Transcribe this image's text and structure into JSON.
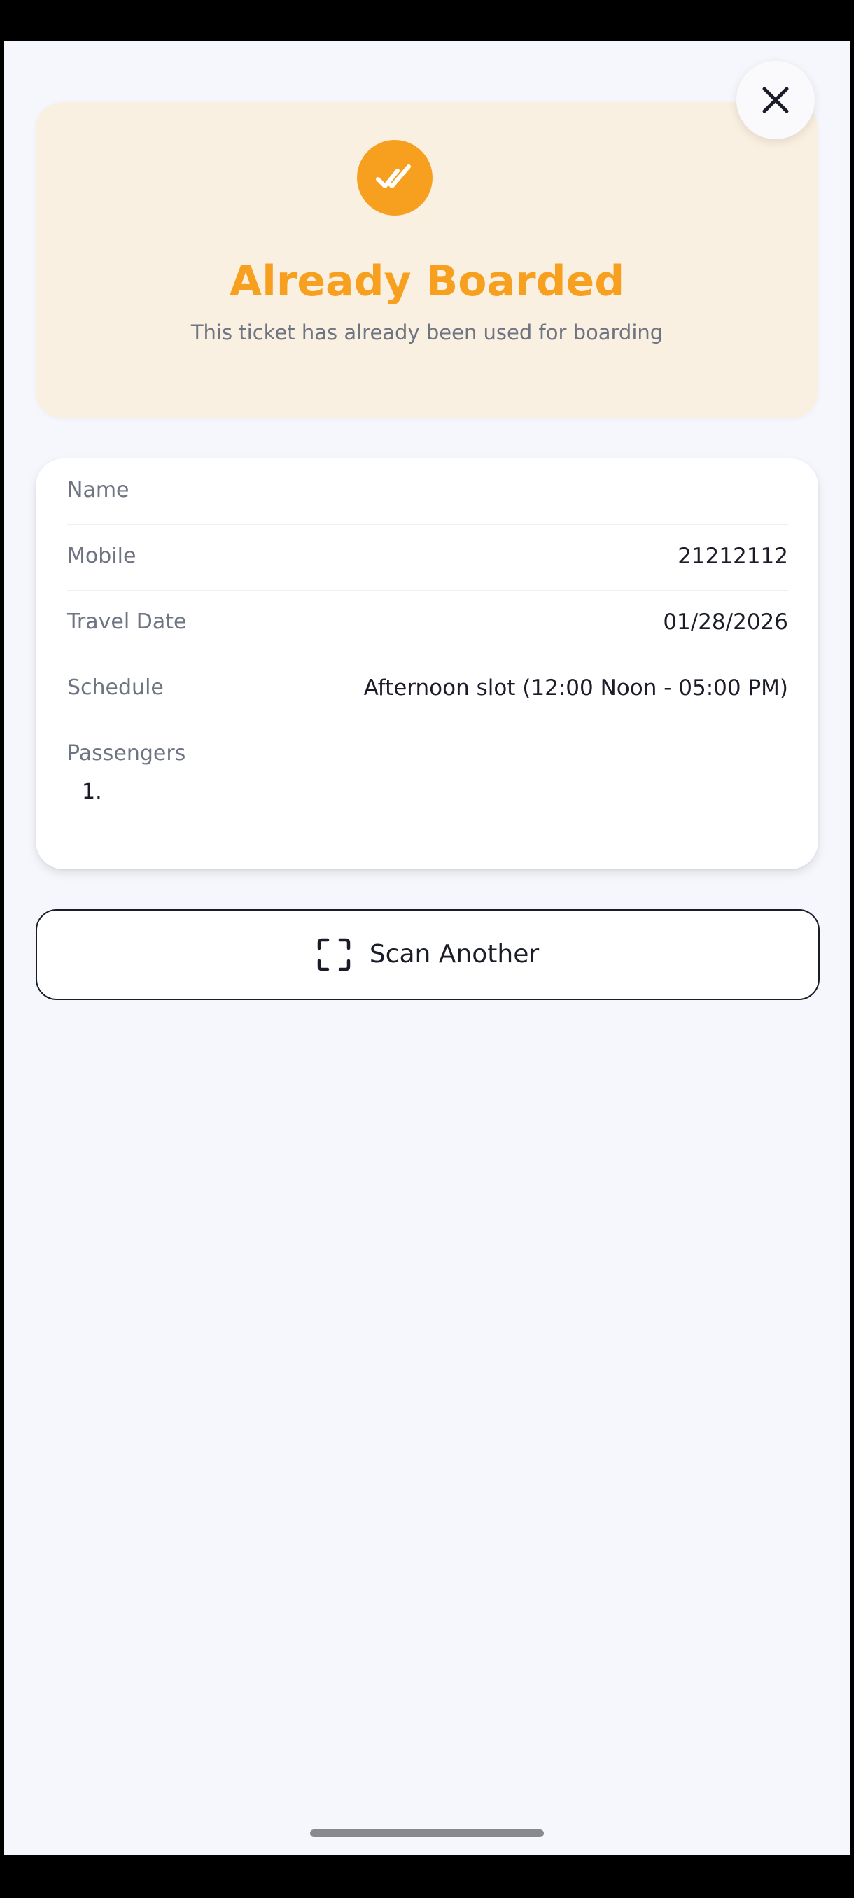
{
  "colors": {
    "accent": "#F7A020",
    "status_background": "#FAF0E1",
    "page_background": "#F6F7FC",
    "text_primary": "#1A1C28",
    "text_secondary": "#6E7481"
  },
  "header": {
    "close_icon": "close-icon"
  },
  "status": {
    "icon": "double-check-icon",
    "title": "Already Boarded",
    "subtitle": "This ticket has already been used for boarding"
  },
  "details": {
    "name_label": "Name",
    "name_value": "",
    "mobile_label": "Mobile",
    "mobile_value": "21212112",
    "travel_date_label": "Travel Date",
    "travel_date_value": "01/28/2026",
    "schedule_label": "Schedule",
    "schedule_value": "Afternoon slot (12:00 Noon - 05:00 PM)",
    "passengers_label": "Passengers",
    "passengers": [
      "1."
    ]
  },
  "actions": {
    "scan_icon": "scan-frame-icon",
    "scan_another_label": "Scan Another"
  }
}
